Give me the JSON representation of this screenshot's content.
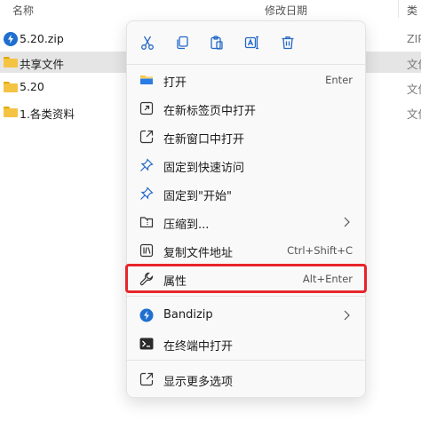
{
  "columns": {
    "name": "名称",
    "modified": "修改日期",
    "type": "类"
  },
  "files": [
    {
      "name": "5.20.zip",
      "type": "ZIP",
      "icon": "zip-icon",
      "selected": false
    },
    {
      "name": "共享文件",
      "type": "文件",
      "icon": "folder-icon",
      "selected": true
    },
    {
      "name": "5.20",
      "type": "文件",
      "icon": "folder-icon",
      "selected": false
    },
    {
      "name": "1.各类资料",
      "type": "文件",
      "icon": "folder-icon",
      "selected": false
    }
  ],
  "toolbar": [
    {
      "name": "cut",
      "icon": "scissors-icon"
    },
    {
      "name": "copy",
      "icon": "copy-icon"
    },
    {
      "name": "paste",
      "icon": "paste-icon"
    },
    {
      "name": "rename",
      "icon": "rename-icon"
    },
    {
      "name": "delete",
      "icon": "trash-icon"
    }
  ],
  "menu": {
    "open": {
      "label": "打开",
      "shortcut": "Enter",
      "icon": "folder-open-icon"
    },
    "open_new_tab": {
      "label": "在新标签页中打开",
      "icon": "new-tab-icon"
    },
    "open_new_window": {
      "label": "在新窗口中打开",
      "icon": "new-window-icon"
    },
    "pin_quick_access": {
      "label": "固定到快速访问",
      "icon": "pin-icon"
    },
    "pin_start": {
      "label": "固定到\"开始\"",
      "icon": "pin-icon"
    },
    "compress": {
      "label": "压缩到...",
      "icon": "zip-folder-icon"
    },
    "copy_path": {
      "label": "复制文件地址",
      "shortcut": "Ctrl+Shift+C",
      "icon": "copy-path-icon"
    },
    "properties": {
      "label": "属性",
      "shortcut": "Alt+Enter",
      "icon": "wrench-icon"
    },
    "bandizip": {
      "label": "Bandizip",
      "icon": "bandizip-icon"
    },
    "terminal": {
      "label": "在终端中打开",
      "icon": "terminal-icon"
    },
    "more_options": {
      "label": "显示更多选项",
      "icon": "more-options-icon"
    }
  },
  "colors": {
    "accent": "#1f6fd1",
    "highlight_border": "#e8252a",
    "selected_row": "#e5e5e5"
  }
}
